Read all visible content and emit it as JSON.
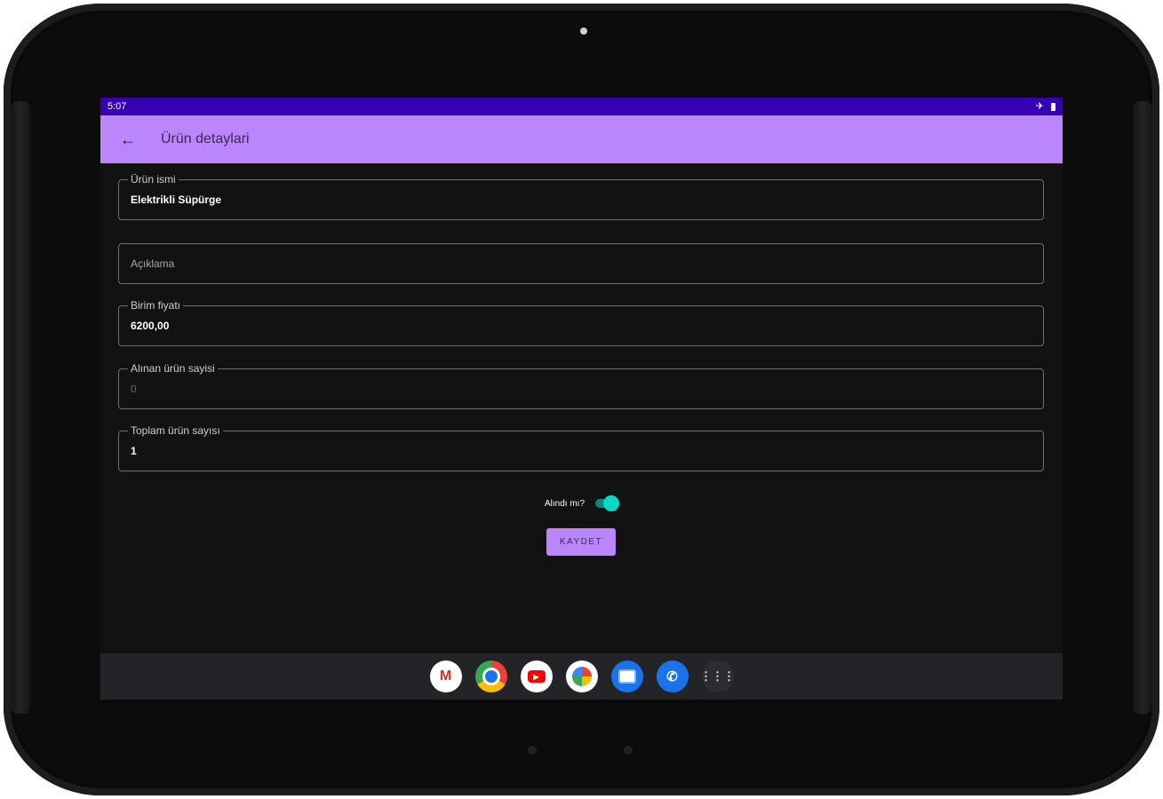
{
  "status_bar": {
    "time": "5:07",
    "icons": [
      "airplane-icon",
      "battery-icon"
    ]
  },
  "app_bar": {
    "back_icon": "←",
    "title": "Ürün detaylari"
  },
  "form": {
    "fields": [
      {
        "label": "Ürün ismi",
        "value": "Elektrikli Süpürge"
      },
      {
        "label": "",
        "placeholder": "Açıklama"
      },
      {
        "label": "Birim fiyatı",
        "value": "6200,00"
      },
      {
        "label": "Alınan ürün sayisi",
        "value": "0"
      },
      {
        "label": "Toplam ürün sayısı",
        "value": "1"
      }
    ],
    "toggle_label": "Alındı mı?",
    "toggle_on": true,
    "save_label": "KAYDET"
  },
  "dock": {
    "apps": [
      "gmail-icon",
      "chrome-icon",
      "youtube-icon",
      "photos-icon",
      "messages-icon",
      "phone-icon",
      "app-drawer-icon"
    ],
    "gmail_glyph": "M",
    "phone_glyph": "✆",
    "apps_glyph": "⋮⋮⋮"
  },
  "colors": {
    "status_bar": "#3700b3",
    "app_bar": "#bb86fc",
    "background": "#121212",
    "toggle_accent": "#03dac5"
  }
}
